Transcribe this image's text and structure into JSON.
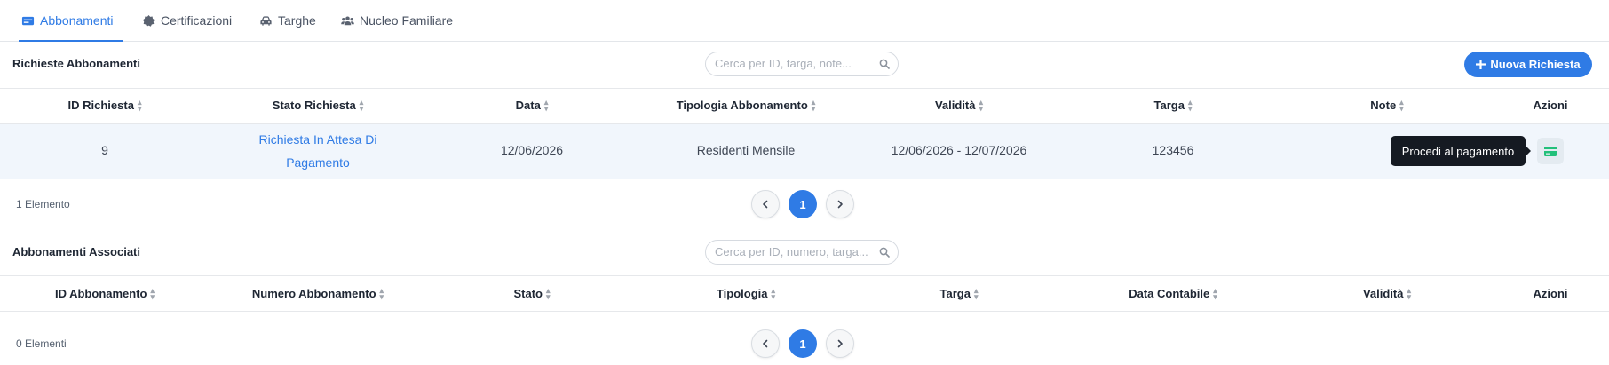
{
  "tabs": [
    {
      "label": "Abbonamenti",
      "icon": "id-card-icon",
      "active": true
    },
    {
      "label": "Certificazioni",
      "icon": "certificate-icon",
      "active": false
    },
    {
      "label": "Targhe",
      "icon": "car-icon",
      "active": false
    },
    {
      "label": "Nucleo Familiare",
      "icon": "users-icon",
      "active": false
    }
  ],
  "requests": {
    "title": "Richieste Abbonamenti",
    "search_placeholder": "Cerca per ID, targa, note...",
    "new_button_label": "Nuova Richiesta",
    "columns": [
      "ID Richiesta",
      "Stato Richiesta",
      "Data",
      "Tipologia Abbonamento",
      "Validità",
      "Targa",
      "Note",
      "Azioni"
    ],
    "rows": [
      {
        "id": "9",
        "status_line1": "Richiesta In Attesa Di",
        "status_line2": "Pagamento",
        "date": "12/06/2026",
        "type": "Residenti Mensile",
        "validity": "12/06/2026 - 12/07/2026",
        "plate": "123456",
        "note": ""
      }
    ],
    "tooltip": "Procedi al pagamento",
    "count_label": "1 Elemento",
    "current_page": "1"
  },
  "associated": {
    "title": "Abbonamenti Associati",
    "search_placeholder": "Cerca per ID, numero, targa...",
    "columns": [
      "ID Abbonamento",
      "Numero Abbonamento",
      "Stato",
      "Tipologia",
      "Targa",
      "Data Contabile",
      "Validità",
      "Azioni"
    ],
    "count_label": "0 Elementi",
    "current_page": "1"
  },
  "colors": {
    "accent": "#2f7be5",
    "pay_icon": "#22c07a",
    "tooltip_bg": "#151a22"
  }
}
